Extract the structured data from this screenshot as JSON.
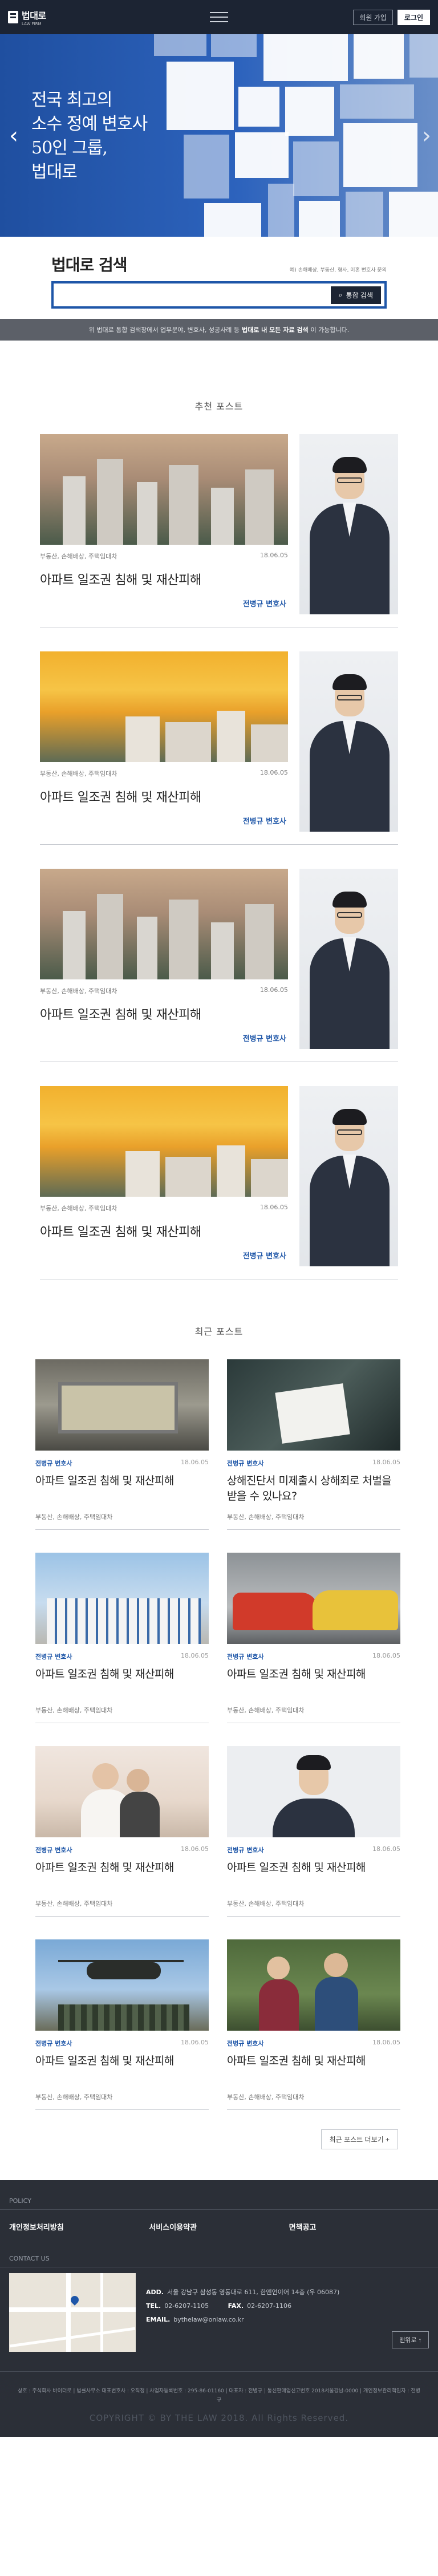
{
  "header": {
    "logo_text": "법대로",
    "logo_sub": "LAW FIRM",
    "join_label": "회원 가입",
    "login_label": "로그인"
  },
  "hero": {
    "line1": "전국 최고의",
    "line2": "소수 정예 변호사",
    "line3": "50인 그룹,",
    "line4": "법대로",
    "prev": "‹",
    "next": "›"
  },
  "search": {
    "title": "법대로 검색",
    "hint": "예) 손해배상, 부동산, 형사, 이혼 변호사 문의",
    "placeholder": "",
    "button_label": "통합 검색"
  },
  "notice": {
    "pre": "위 법대로 통합 검색창에서 업무분야, 변호사, 성공사례 등",
    "bold": "법대로 내 모든 자료 검색",
    "post": "이 가능합니다."
  },
  "recommended": {
    "title": "추천 포스트",
    "items": [
      {
        "tags": "부동산, 손해배상, 주택임대차",
        "date": "18.06.05",
        "title": "아파트 일조권 침해 및 재산피해",
        "lawyer": "전병규 변호사"
      },
      {
        "tags": "부동산, 손해배상, 주택임대차",
        "date": "18.06.05",
        "title": "아파트 일조권 침해 및 재산피해",
        "lawyer": "전병규 변호사"
      },
      {
        "tags": "부동산, 손해배상, 주택임대차",
        "date": "18.06.05",
        "title": "아파트 일조권 침해 및 재산피해",
        "lawyer": "전병규 변호사"
      },
      {
        "tags": "부동산, 손해배상, 주택임대차",
        "date": "18.06.05",
        "title": "아파트 일조권 침해 및 재산피해",
        "lawyer": "전병규 변호사"
      }
    ]
  },
  "recent": {
    "title": "최근 포스트",
    "items": [
      {
        "lawyer": "전병규 변호사",
        "date": "18.06.05",
        "title": "아파트 일조권 침해 및 재산피해",
        "tags": "부동산, 손해배상, 주택임대차"
      },
      {
        "lawyer": "전병규 변호사",
        "date": "18.06.05",
        "title": "상해진단서 미제출시 상해죄로 처벌을 받을 수 있나요?",
        "tags": "부동산, 손해배상, 주택임대차"
      },
      {
        "lawyer": "전병규 변호사",
        "date": "18.06.05",
        "title": "아파트 일조권 침해 및 재산피해",
        "tags": "부동산, 손해배상, 주택임대차"
      },
      {
        "lawyer": "전병규 변호사",
        "date": "18.06.05",
        "title": "아파트 일조권 침해 및 재산피해",
        "tags": "부동산, 손해배상, 주택임대차"
      },
      {
        "lawyer": "전병규 변호사",
        "date": "18.06.05",
        "title": "아파트 일조권 침해 및 재산피해",
        "tags": "부동산, 손해배상, 주택임대차"
      },
      {
        "lawyer": "전병규 변호사",
        "date": "18.06.05",
        "title": "아파트 일조권 침해 및 재산피해",
        "tags": "부동산, 손해배상, 주택임대차"
      },
      {
        "lawyer": "전병규 변호사",
        "date": "18.06.05",
        "title": "아파트 일조권 침해 및 재산피해",
        "tags": "부동산, 손해배상, 주택임대차"
      },
      {
        "lawyer": "전병규 변호사",
        "date": "18.06.05",
        "title": "아파트 일조권 침해 및 재산피해",
        "tags": "부동산, 손해배상, 주택임대차"
      }
    ],
    "more_label": "최근 포스트 더보기 +"
  },
  "footer": {
    "policy_label": "POLICY",
    "link1": "개인정보처리방침",
    "link2": "서비스이용약관",
    "link3": "면책공고",
    "contact_label": "CONTACT US",
    "add_label": "ADD.",
    "add_value": "서울 강남구 삼성동 영동대로 611, 한엔언이어 14층 (우 06087)",
    "tel_label": "TEL.",
    "tel_value": "02-6207-1105",
    "fax_label": "FAX.",
    "fax_value": "02-6207-1106",
    "email_label": "EMAIL.",
    "email_value": "bythelaw@onlaw.co.kr",
    "top_label": "맨위로 ↑",
    "legal": "상호 : 주식회사 바이더로 | 법률사무소 대표변호사 : 오직정 | 사업자등록번호 : 295-86-01160 | 대표자 : 전병규 | 통신판매업신고번호 2018서울강남-0000 | 개인정보관리책임자 : 전병규",
    "copyright": "COPYRIGHT © BY THE LAW 2018. All Rights Reserved."
  }
}
